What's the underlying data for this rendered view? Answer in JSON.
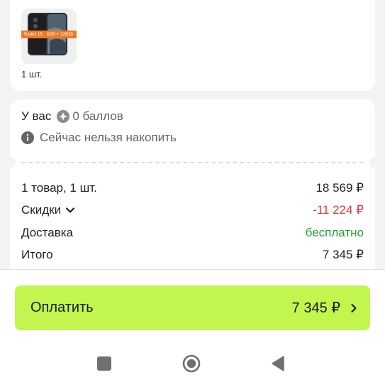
{
  "product": {
    "badge_model": "Redmi 15",
    "badge_spec": "6GB + 128GB",
    "quantity": "1 шт."
  },
  "points": {
    "prefix": "У вас",
    "value": "0 баллов",
    "info": "Сейчас нельзя накопить"
  },
  "summary": {
    "items_label": "1 товар, 1 шт.",
    "items_value": "18 569 ₽",
    "discount_label": "Скидки",
    "discount_value": "-11 224 ₽",
    "delivery_label": "Доставка",
    "delivery_value": "бесплатно",
    "total_label": "Итого",
    "total_value": "7 345 ₽"
  },
  "pay_button": {
    "label": "Оплатить",
    "amount": "7 345 ₽"
  },
  "colors": {
    "accent": "#c2f54e",
    "discount": "#d83a3a",
    "free": "#2a9d3a",
    "badge": "#f07a22"
  },
  "icons": [
    "points-coin-icon",
    "info-icon",
    "chevron-down-icon",
    "chevron-right-icon",
    "nav-recent-icon",
    "nav-home-icon",
    "nav-back-icon"
  ]
}
